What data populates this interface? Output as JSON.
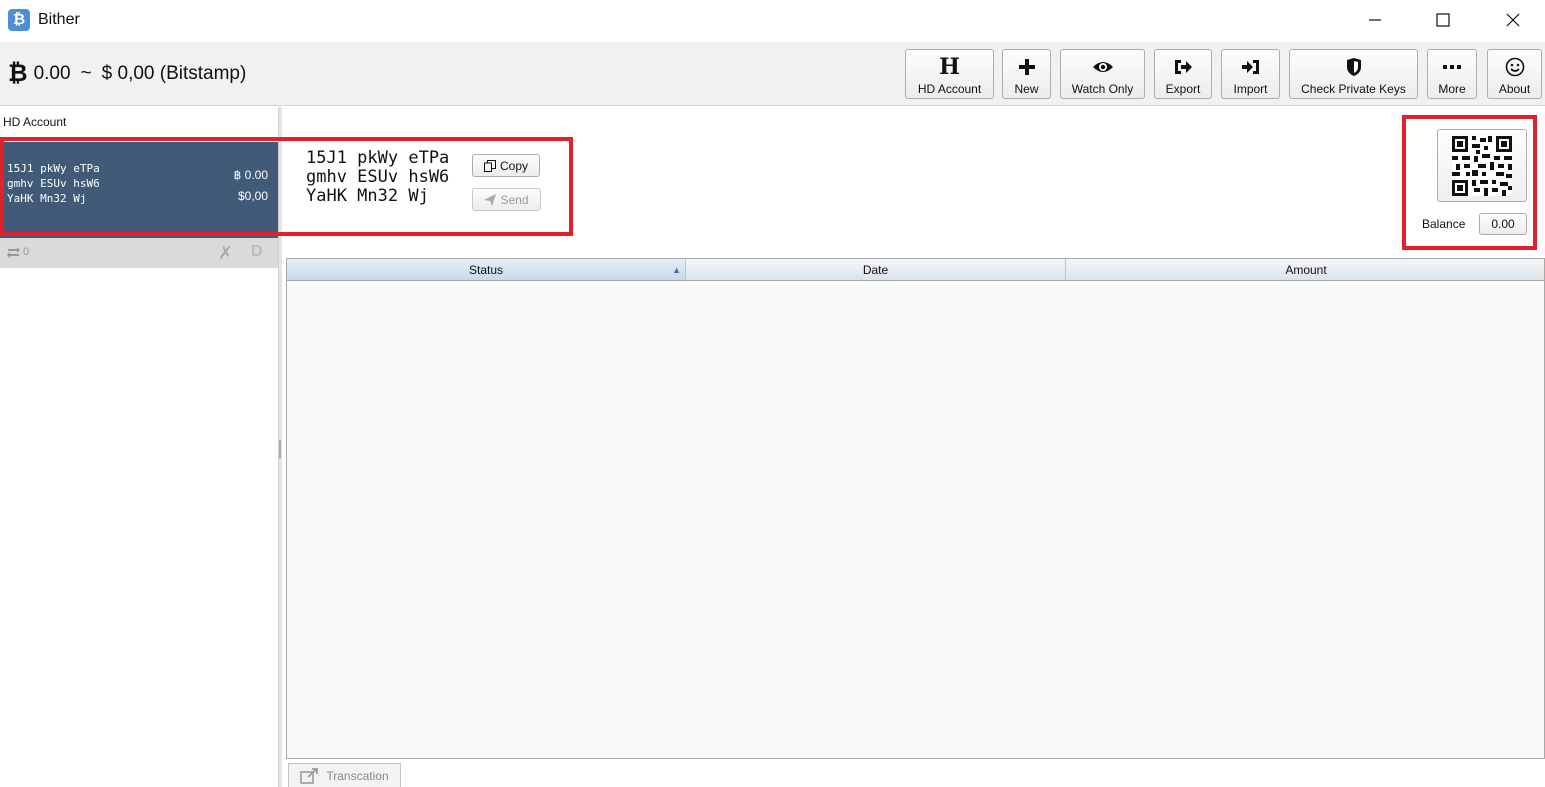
{
  "window": {
    "title": "Bither",
    "app_icon_glyph": "₿",
    "controls": [
      "minimize",
      "maximize",
      "close"
    ]
  },
  "header": {
    "btc_balance": "0.00",
    "separator": "~",
    "fiat_balance": "$ 0,00 (Bitstamp)"
  },
  "toolbar": {
    "buttons": [
      {
        "label": "HD Account",
        "icon": "hd-letter-icon"
      },
      {
        "label": "New",
        "icon": "plus-icon"
      },
      {
        "label": "Watch Only",
        "icon": "eye-icon"
      },
      {
        "label": "Export",
        "icon": "export-icon"
      },
      {
        "label": "Import",
        "icon": "import-icon"
      },
      {
        "label": "Check Private Keys",
        "icon": "shield-icon"
      },
      {
        "label": "More",
        "icon": "ellipsis-icon"
      },
      {
        "label": "About",
        "icon": "smiley-icon"
      }
    ],
    "hd_glyph": "H"
  },
  "sidebar": {
    "title": "HD Account",
    "account": {
      "address": "15J1 pkWy eTPa\ngmhv ESUv hsW6\nYaHK Mn32 Wj",
      "btc": "฿ 0.00",
      "usd": "$0,00"
    },
    "tx_count": "0",
    "footer_icon_d": "D"
  },
  "main": {
    "address": "15J1 pkWy eTPa\ngmhv ESUv hsW6\nYaHK Mn32 Wj",
    "copy_label": "Copy",
    "send_label": "Send",
    "balance_label": "Balance",
    "balance_value": "0.00"
  },
  "table": {
    "columns": [
      "Status",
      "Date",
      "Amount"
    ],
    "sorted_column": "Status",
    "rows": []
  },
  "bottom": {
    "transaction_label": "Transcation"
  },
  "colors": {
    "account_card_bg": "#415a78",
    "highlight": "#e0202a",
    "app_icon": "#4d8fd4"
  }
}
